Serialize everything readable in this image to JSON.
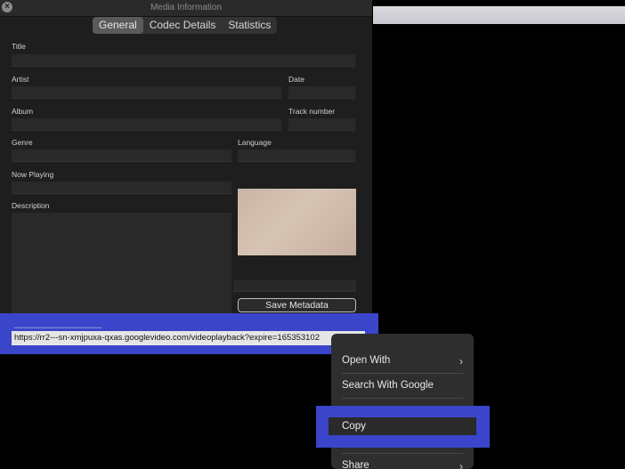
{
  "window": {
    "title": "Media Information",
    "tabs": [
      {
        "label": "General",
        "active": true
      },
      {
        "label": "Codec Details",
        "active": false
      },
      {
        "label": "Statistics",
        "active": false
      }
    ]
  },
  "form": {
    "title_label": "Title",
    "artist_label": "Artist",
    "date_label": "Date",
    "album_label": "Album",
    "track_label": "Track number",
    "genre_label": "Genre",
    "language_label": "Language",
    "now_playing_label": "Now Playing",
    "description_label": "Description",
    "save_label": "Save Metadata"
  },
  "location": {
    "url": "https://rr2---sn-xmjpuxa-qxas.googlevideo.com/videoplayback?expire=165353102"
  },
  "context_menu": {
    "items": [
      {
        "label": "Open With",
        "submenu": true
      },
      {
        "label": "Search With Google",
        "submenu": false
      },
      {
        "label": "Copy",
        "submenu": false
      },
      {
        "label": "Share",
        "submenu": true
      }
    ]
  },
  "colors": {
    "highlight": "#3b45c9",
    "panel": "#1e1e1e"
  }
}
